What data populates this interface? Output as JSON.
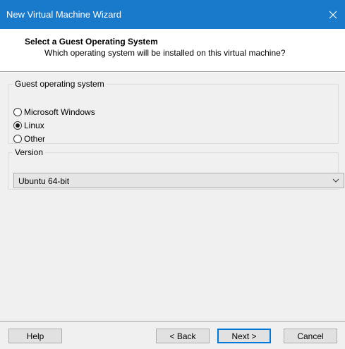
{
  "window": {
    "title": "New Virtual Machine Wizard",
    "close_icon": "close-icon"
  },
  "header": {
    "title": "Select a Guest Operating System",
    "subtitle": "Which operating system will be installed on this virtual machine?"
  },
  "guest_os": {
    "legend": "Guest operating system",
    "options": [
      {
        "label": "Microsoft Windows",
        "checked": false
      },
      {
        "label": "Linux",
        "checked": true
      },
      {
        "label": "Other",
        "checked": false
      }
    ]
  },
  "version": {
    "legend": "Version",
    "selected": "Ubuntu 64-bit"
  },
  "footer": {
    "help": "Help",
    "back": "< Back",
    "next": "Next >",
    "cancel": "Cancel"
  },
  "colors": {
    "titlebar": "#1979ca",
    "panel": "#f0f0f0",
    "default_button_border": "#0078d7"
  }
}
